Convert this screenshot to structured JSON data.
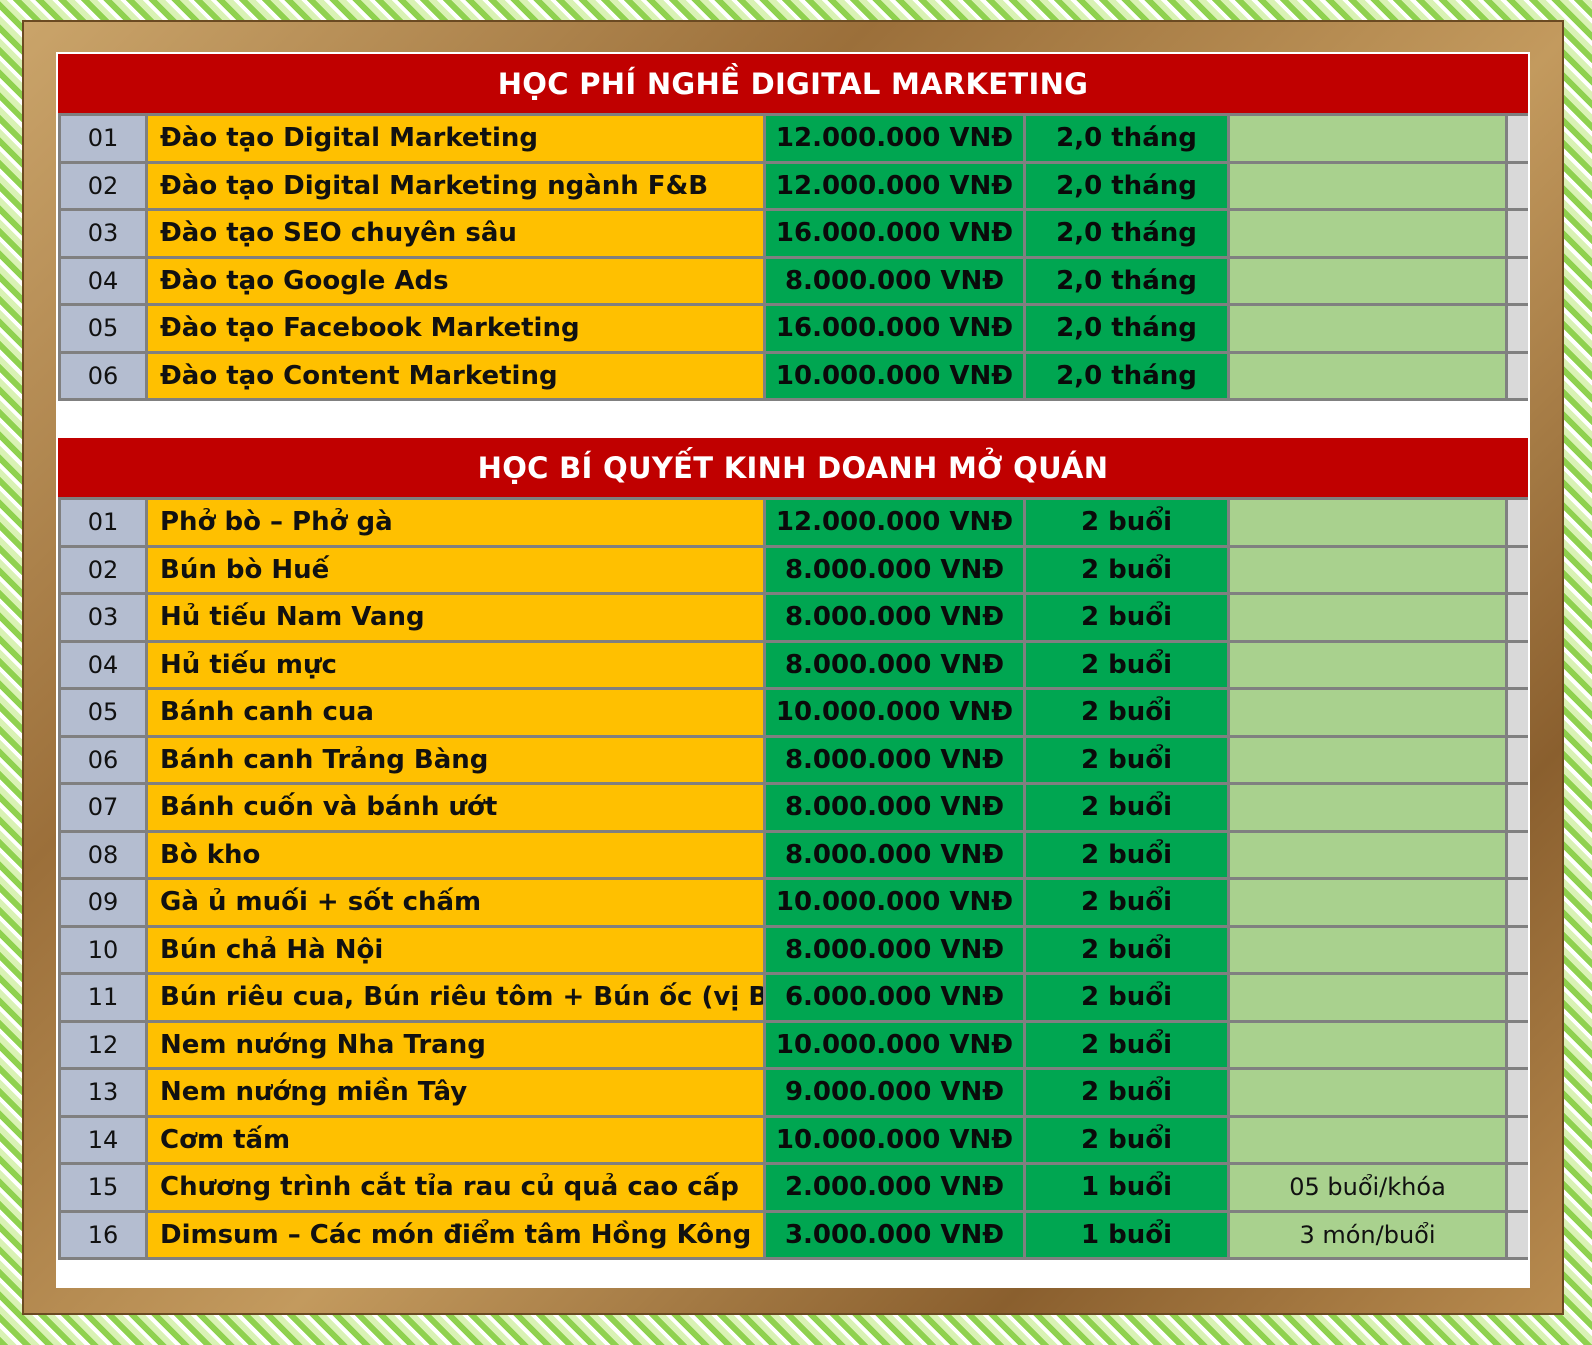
{
  "sections": [
    {
      "title": "HỌC PHÍ NGHỀ DIGITAL MARKETING",
      "rows": [
        {
          "no": "01",
          "name": "Đào tạo Digital Marketing",
          "price": "12.000.000 VNĐ",
          "duration": "2,0 tháng",
          "note": ""
        },
        {
          "no": "02",
          "name": "Đào tạo Digital Marketing ngành F&B",
          "price": "12.000.000 VNĐ",
          "duration": "2,0 tháng",
          "note": ""
        },
        {
          "no": "03",
          "name": "Đào tạo SEO chuyên sâu",
          "price": "16.000.000 VNĐ",
          "duration": "2,0 tháng",
          "note": ""
        },
        {
          "no": "04",
          "name": "Đào tạo Google Ads",
          "price": "8.000.000 VNĐ",
          "duration": "2,0 tháng",
          "note": ""
        },
        {
          "no": "05",
          "name": "Đào tạo Facebook Marketing",
          "price": "16.000.000 VNĐ",
          "duration": "2,0 tháng",
          "note": ""
        },
        {
          "no": "06",
          "name": "Đào tạo Content Marketing",
          "price": "10.000.000 VNĐ",
          "duration": "2,0 tháng",
          "note": ""
        }
      ]
    },
    {
      "title": "HỌC BÍ QUYẾT KINH DOANH MỞ QUÁN",
      "rows": [
        {
          "no": "01",
          "name": "Phở bò – Phở gà",
          "price": "12.000.000 VNĐ",
          "duration": "2 buổi",
          "note": ""
        },
        {
          "no": "02",
          "name": "Bún bò Huế",
          "price": "8.000.000 VNĐ",
          "duration": "2 buổi",
          "note": ""
        },
        {
          "no": "03",
          "name": "Hủ tiếu Nam Vang",
          "price": "8.000.000 VNĐ",
          "duration": "2 buổi",
          "note": ""
        },
        {
          "no": "04",
          "name": "Hủ tiếu mực",
          "price": "8.000.000 VNĐ",
          "duration": "2 buổi",
          "note": ""
        },
        {
          "no": "05",
          "name": "Bánh canh cua",
          "price": "10.000.000 VNĐ",
          "duration": "2 buổi",
          "note": ""
        },
        {
          "no": "06",
          "name": "Bánh canh Trảng Bàng",
          "price": "8.000.000 VNĐ",
          "duration": "2 buổi",
          "note": ""
        },
        {
          "no": "07",
          "name": "Bánh cuốn và bánh ướt",
          "price": "8.000.000 VNĐ",
          "duration": "2 buổi",
          "note": ""
        },
        {
          "no": "08",
          "name": "Bò kho",
          "price": "8.000.000 VNĐ",
          "duration": "2 buổi",
          "note": ""
        },
        {
          "no": "09",
          "name": "Gà ủ muối + sốt chấm",
          "price": "10.000.000 VNĐ",
          "duration": "2 buổi",
          "note": ""
        },
        {
          "no": "10",
          "name": "Bún chả Hà Nội",
          "price": "8.000.000 VNĐ",
          "duration": "2 buổi",
          "note": ""
        },
        {
          "no": "11",
          "name": "Bún riêu cua, Bún riêu tôm + Bún ốc (vị Bắc)",
          "price": "6.000.000 VNĐ",
          "duration": "2 buổi",
          "note": ""
        },
        {
          "no": "12",
          "name": "Nem nướng Nha Trang",
          "price": "10.000.000 VNĐ",
          "duration": "2 buổi",
          "note": ""
        },
        {
          "no": "13",
          "name": "Nem nướng miền Tây",
          "price": "9.000.000 VNĐ",
          "duration": "2 buổi",
          "note": ""
        },
        {
          "no": "14",
          "name": "Cơm tấm",
          "price": "10.000.000 VNĐ",
          "duration": "2 buổi",
          "note": ""
        },
        {
          "no": "15",
          "name": "Chương trình cắt tỉa rau củ quả cao cấp",
          "price": "2.000.000 VNĐ",
          "duration": "1 buổi",
          "note": "05 buổi/khóa"
        },
        {
          "no": "16",
          "name": "Dimsum – Các món điểm tâm Hồng Kông",
          "price": "3.000.000 VNĐ",
          "duration": "1 buổi",
          "note": "3 món/buổi"
        }
      ]
    }
  ],
  "colors": {
    "header_bg": "#c00000",
    "number_bg": "#b4bdd0",
    "name_bg": "#ffc000",
    "price_bg": "#00a651",
    "note_bg": "#a9d18e"
  }
}
